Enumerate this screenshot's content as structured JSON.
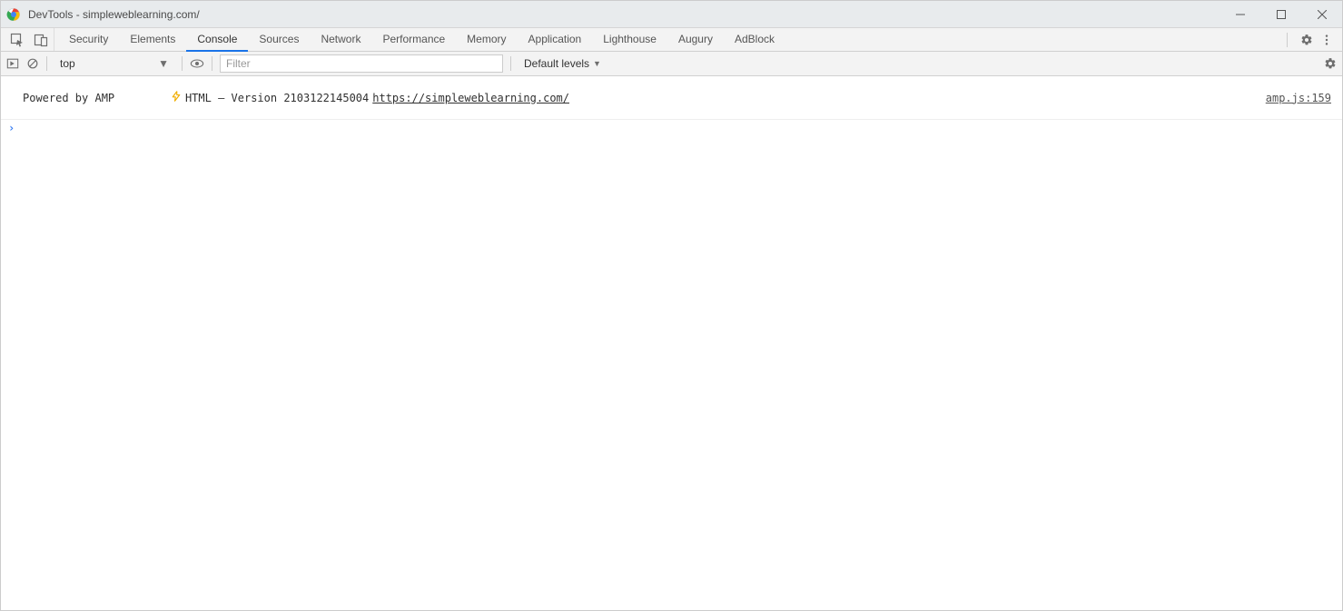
{
  "window": {
    "title": "DevTools - simpleweblearning.com/"
  },
  "tabs": [
    {
      "label": "Security",
      "active": false
    },
    {
      "label": "Elements",
      "active": false
    },
    {
      "label": "Console",
      "active": true
    },
    {
      "label": "Sources",
      "active": false
    },
    {
      "label": "Network",
      "active": false
    },
    {
      "label": "Performance",
      "active": false
    },
    {
      "label": "Memory",
      "active": false
    },
    {
      "label": "Application",
      "active": false
    },
    {
      "label": "Lighthouse",
      "active": false
    },
    {
      "label": "Augury",
      "active": false
    },
    {
      "label": "AdBlock",
      "active": false
    }
  ],
  "toolbar": {
    "context": "top",
    "filter_placeholder": "Filter",
    "levels_label": "Default levels"
  },
  "log": {
    "prefix": "Powered by AMP",
    "mid": "HTML – Version 2103122145004",
    "url": "https://simpleweblearning.com/",
    "source": "amp.js:159"
  }
}
